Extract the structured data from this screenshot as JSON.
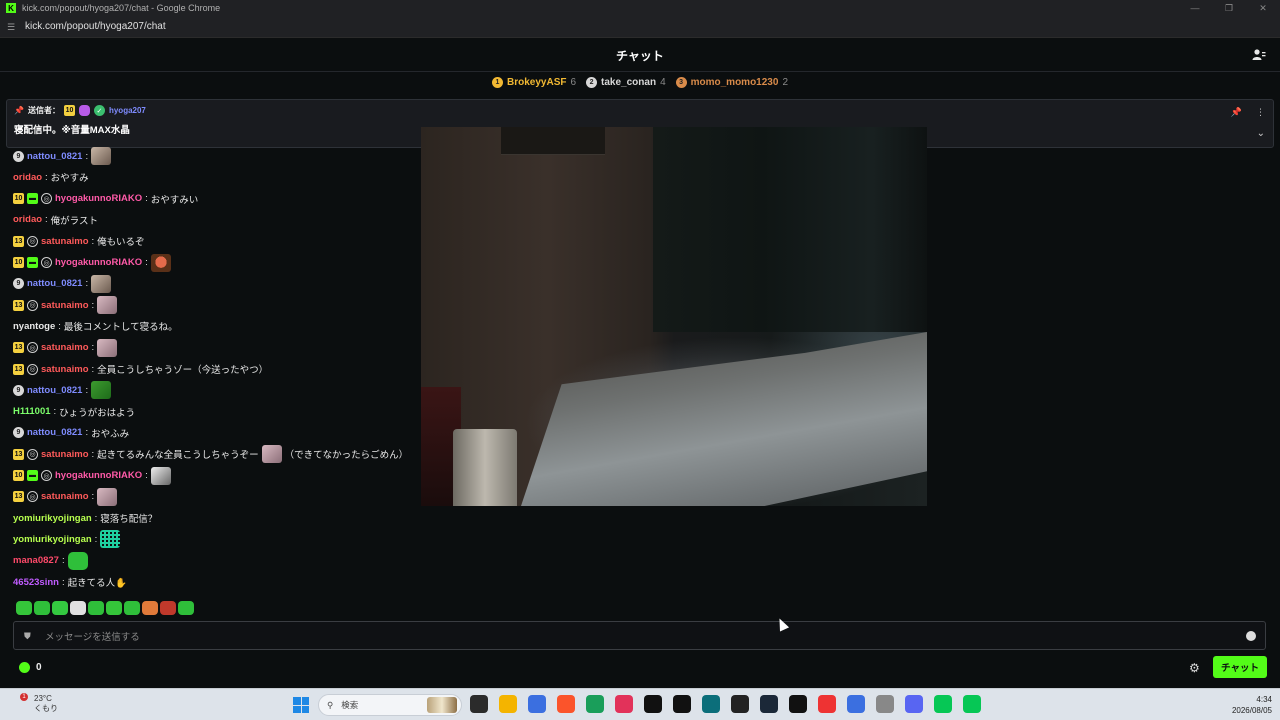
{
  "browser": {
    "title": "kick.com/popout/hyoga207/chat - Google Chrome",
    "url": "kick.com/popout/hyoga207/chat",
    "logo_letter": "K"
  },
  "chat": {
    "header_title": "チャット",
    "leaderboard": [
      {
        "rank": "1",
        "name": "BrokeyyASF",
        "count": "6",
        "color": "#f2b933"
      },
      {
        "rank": "2",
        "name": "take_conan",
        "count": "4",
        "color": "#d7d7d7"
      },
      {
        "rank": "3",
        "name": "momo_momo1230",
        "count": "2",
        "color": "#d98b4a"
      }
    ],
    "pinned": {
      "sender_label": "送信者：",
      "sub_badge": "10",
      "sender": "hyoga207",
      "message": "寝配信中。※音量MAX水晶"
    },
    "messages": [
      {
        "badges": [
          "round:9"
        ],
        "user": "nattou_0821",
        "color": "#7f8cff",
        "text": "",
        "emote": "cat"
      },
      {
        "badges": [],
        "user": "oridao",
        "color": "#ff5a5a",
        "text": "おやすみ"
      },
      {
        "badges": [
          "sub:10",
          "gift:",
          "og:"
        ],
        "user": "hyogakunnoRIAKO",
        "color": "#ff5aa8",
        "text": "おやすみい"
      },
      {
        "badges": [],
        "user": "oridao",
        "color": "#ff5a5a",
        "text": "俺がラスト"
      },
      {
        "badges": [
          "sub:13",
          "og:"
        ],
        "user": "satunaimo",
        "color": "#ff5a5a",
        "text": "俺もいるぞ"
      },
      {
        "badges": [
          "sub:10",
          "gift:",
          "og:"
        ],
        "user": "hyogakunnoRIAKO",
        "color": "#ff5aa8",
        "text": "",
        "emote": "face"
      },
      {
        "badges": [
          "round:9"
        ],
        "user": "nattou_0821",
        "color": "#7f8cff",
        "text": "",
        "emote": "cat"
      },
      {
        "badges": [
          "sub:13",
          "og:"
        ],
        "user": "satunaimo",
        "color": "#ff5a5a",
        "text": "",
        "emote": "pink"
      },
      {
        "badges": [],
        "user": "nyantoge",
        "color": "#e8e8e8",
        "text": "最後コメントして寝るね。"
      },
      {
        "badges": [
          "sub:13",
          "og:"
        ],
        "user": "satunaimo",
        "color": "#ff5a5a",
        "text": "",
        "emote": "pink"
      },
      {
        "badges": [
          "sub:13",
          "og:"
        ],
        "user": "satunaimo",
        "color": "#ff5a5a",
        "text": "全員こうしちゃうゾー（今送ったやつ）"
      },
      {
        "badges": [
          "round:9"
        ],
        "user": "nattou_0821",
        "color": "#7f8cff",
        "text": "",
        "emote": "frog"
      },
      {
        "badges": [],
        "user": "H111001",
        "color": "#7cff6b",
        "text": "ひょうがおはよう"
      },
      {
        "badges": [
          "round:9"
        ],
        "user": "nattou_0821",
        "color": "#7f8cff",
        "text": "おやふみ"
      },
      {
        "badges": [
          "sub:13",
          "og:"
        ],
        "user": "satunaimo",
        "color": "#ff5a5a",
        "text": "起きてるみんな全員こうしちゃうぞー",
        "emote": "pink",
        "text_after": "（できてなかったらごめん）"
      },
      {
        "badges": [
          "sub:10",
          "gift:",
          "og:"
        ],
        "user": "hyogakunnoRIAKO",
        "color": "#ff5aa8",
        "text": "",
        "emote": "bw"
      },
      {
        "badges": [
          "sub:13",
          "og:"
        ],
        "user": "satunaimo",
        "color": "#ff5a5a",
        "text": "",
        "emote": "pink"
      },
      {
        "badges": [],
        "user": "yomiurikyojingan",
        "color": "#b7ff4f",
        "text": "寝落ち配信？"
      },
      {
        "badges": [],
        "user": "yomiurikyojingan",
        "color": "#b7ff4f",
        "text": "",
        "emote": "grid"
      },
      {
        "badges": [],
        "user": "mana0827",
        "color": "#ff4a6a",
        "text": "",
        "emote": "green"
      },
      {
        "badges": [],
        "user": "46523sinn",
        "color": "#c05cff",
        "text": "起きてる人✋"
      }
    ],
    "emote_bar_colors": [
      "#35c53a",
      "#2fbf3a",
      "#34c940",
      "#e0e0e0",
      "#2fbf3a",
      "#35c53a",
      "#2fbf3a",
      "#e07a3a",
      "#c0392b",
      "#2fbf3a"
    ],
    "composer_placeholder": "メッセージを送信する",
    "points": "0",
    "send_button": "チャット"
  },
  "taskbar": {
    "weather_badge": "1",
    "temperature": "23°C",
    "condition": "くもり",
    "search_label": "検索",
    "time": "4:34",
    "date": "2026/08/05",
    "app_colors": [
      "#2b2b2b",
      "#f4b400",
      "#3b6fe0",
      "#fb542b",
      "#1a9e5a",
      "#e2325a",
      "#111",
      "#111",
      "#0b6e7a",
      "#222",
      "#1b2838",
      "#111",
      "#e33",
      "#3b6fe0",
      "#888",
      "#5865f2",
      "#06c755",
      "#06c755"
    ]
  }
}
